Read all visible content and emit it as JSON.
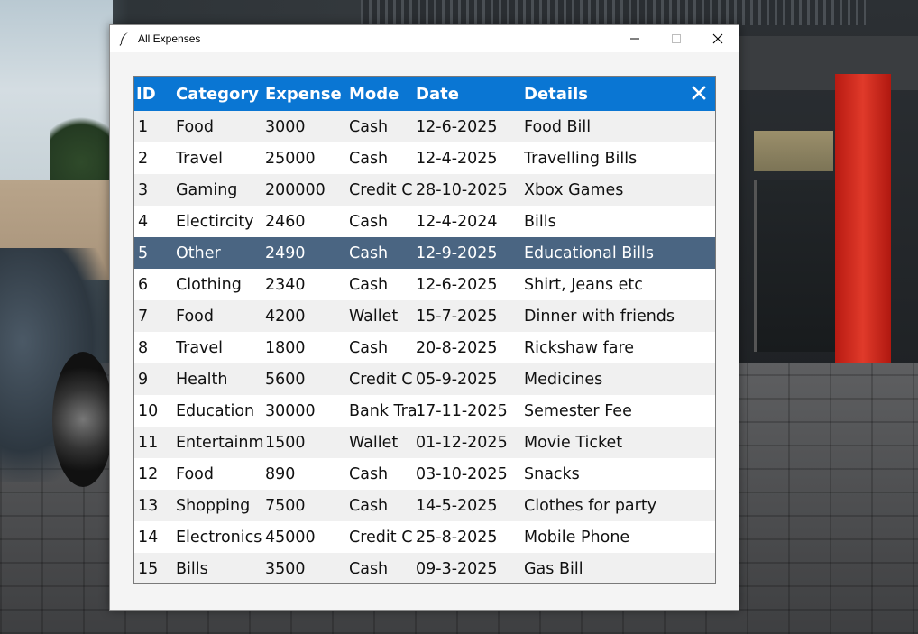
{
  "window": {
    "title": "All Expenses",
    "controls": {
      "minimize_icon": "minimize-icon",
      "maximize_icon": "maximize-icon",
      "close_icon": "close-icon"
    }
  },
  "table": {
    "header_color": "#0a76d3",
    "selected_color": "#4a6582",
    "columns": [
      "ID",
      "Category",
      "Expense",
      "Mode",
      "Date",
      "Details"
    ],
    "rows": [
      [
        "1",
        "Food",
        "3000",
        "Cash",
        "12-6-2025",
        "Food Bill"
      ],
      [
        "2",
        "Travel",
        "25000",
        "Cash",
        "12-4-2025",
        "Travelling Bills"
      ],
      [
        "3",
        "Gaming",
        "200000",
        "Credit C",
        "28-10-2025",
        "Xbox Games"
      ],
      [
        "4",
        "Electircity",
        "2460",
        "Cash",
        "12-4-2024",
        "Bills"
      ],
      [
        "5",
        "Other",
        "2490",
        "Cash",
        "12-9-2025",
        "Educational Bills"
      ],
      [
        "6",
        "Clothing",
        "2340",
        "Cash",
        "12-6-2025",
        "Shirt, Jeans etc"
      ],
      [
        "7",
        "Food",
        "4200",
        "Wallet",
        "15-7-2025",
        "Dinner with friends"
      ],
      [
        "8",
        "Travel",
        "1800",
        "Cash",
        "20-8-2025",
        "Rickshaw fare"
      ],
      [
        "9",
        "Health",
        "5600",
        "Credit C",
        "05-9-2025",
        "Medicines"
      ],
      [
        "10",
        "Education",
        "30000",
        "Bank Tra",
        "17-11-2025",
        "Semester Fee"
      ],
      [
        "11",
        "Entertainm",
        "1500",
        "Wallet",
        "01-12-2025",
        "Movie Ticket"
      ],
      [
        "12",
        "Food",
        "890",
        "Cash",
        "03-10-2025",
        "Snacks"
      ],
      [
        "13",
        "Shopping",
        "7500",
        "Cash",
        "14-5-2025",
        "Clothes for party"
      ],
      [
        "14",
        "Electronics",
        "45000",
        "Credit C",
        "25-8-2025",
        "Mobile Phone"
      ],
      [
        "15",
        "Bills",
        "3500",
        "Cash",
        "09-3-2025",
        "Gas Bill"
      ]
    ],
    "selected_row": 4
  }
}
